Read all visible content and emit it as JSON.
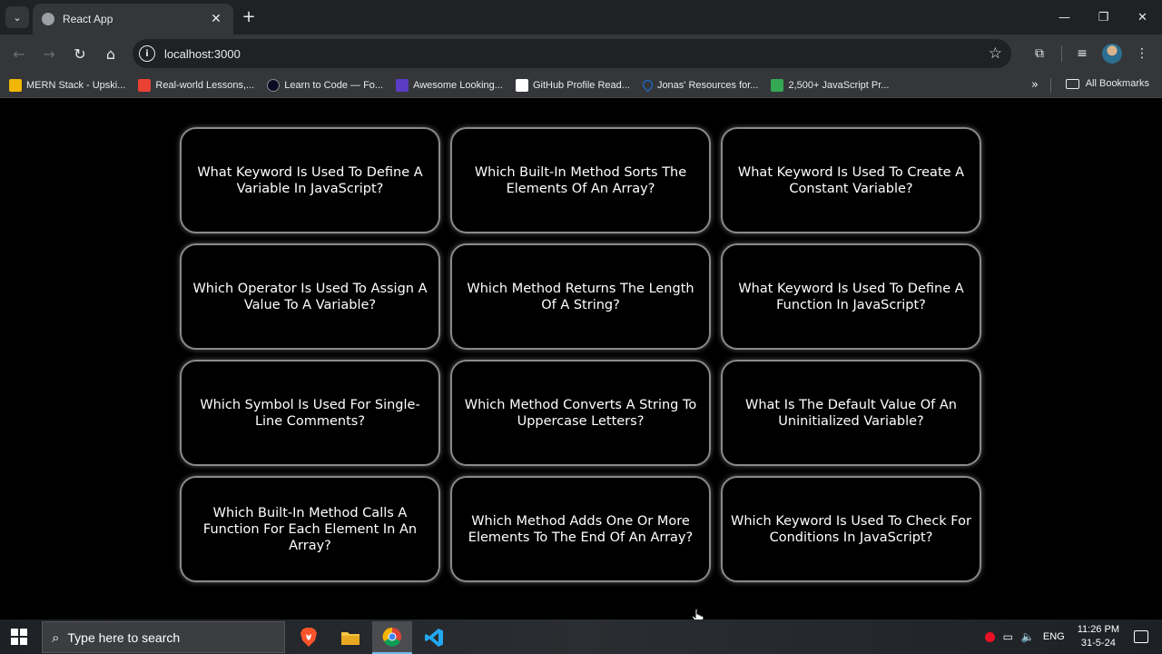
{
  "browser": {
    "tab": {
      "title": "React App"
    },
    "address": {
      "url": "localhost:3000"
    },
    "bookmarks": [
      {
        "label": "MERN Stack - Upski...",
        "color": "#f2b705"
      },
      {
        "label": "Real-world Lessons,...",
        "color": "#e94235"
      },
      {
        "label": "Learn to Code — Fo...",
        "color": "#0a0a23"
      },
      {
        "label": "Awesome Looking...",
        "color": "#5b3cc4"
      },
      {
        "label": "GitHub Profile Read...",
        "color": "#ffffff"
      },
      {
        "label": "Jonas' Resources for...",
        "color": "#1a73e8"
      },
      {
        "label": "2,500+ JavaScript Pr...",
        "color": "#34a853"
      }
    ],
    "all_bookmarks_label": "All Bookmarks"
  },
  "cards": [
    "What Keyword Is Used To Define A Variable In JavaScript?",
    "Which Built-In Method Sorts The Elements Of An Array?",
    "What Keyword Is Used To Create A Constant Variable?",
    "Which Operator Is Used To Assign A Value To A Variable?",
    "Which Method Returns The Length Of A String?",
    "What Keyword Is Used To Define A Function In JavaScript?",
    "Which Symbol Is Used For Single-Line Comments?",
    "Which Method Converts A String To Uppercase Letters?",
    "What Is The Default Value Of An Uninitialized Variable?",
    "Which Built-In Method Calls A Function For Each Element In An Array?",
    "Which Method Adds One Or More Elements To The End Of An Array?",
    "Which Keyword Is Used To Check For Conditions In JavaScript?"
  ],
  "taskbar": {
    "search_placeholder": "Type here to search",
    "language": "ENG",
    "time": "11:26 PM",
    "date": "31-5-24"
  }
}
